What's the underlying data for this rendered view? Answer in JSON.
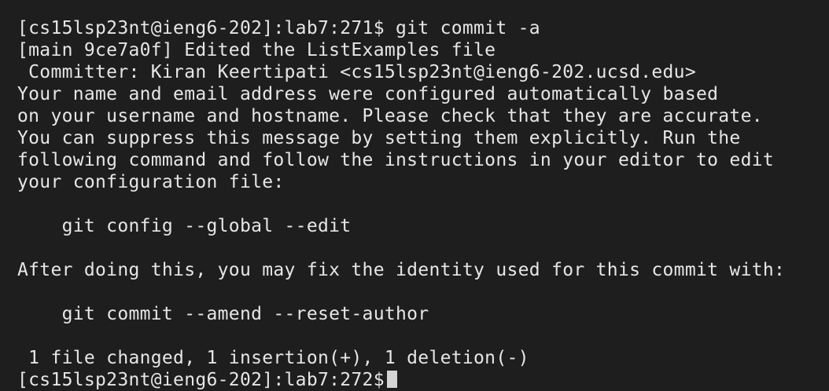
{
  "terminal": {
    "lines": [
      "[cs15lsp23nt@ieng6-202]:lab7:271$ git commit -a",
      "[main 9ce7a0f] Edited the ListExamples file",
      " Committer: Kiran Keertipati <cs15lsp23nt@ieng6-202.ucsd.edu>",
      "Your name and email address were configured automatically based",
      "on your username and hostname. Please check that they are accurate.",
      "You can suppress this message by setting them explicitly. Run the",
      "following command and follow the instructions in your editor to edit",
      "your configuration file:",
      "",
      "    git config --global --edit",
      "",
      "After doing this, you may fix the identity used for this commit with:",
      "",
      "    git commit --amend --reset-author",
      "",
      " 1 file changed, 1 insertion(+), 1 deletion(-)"
    ],
    "prompt": "[cs15lsp23nt@ieng6-202]:lab7:272$"
  },
  "colors": {
    "background": "#1e1e1e",
    "foreground": "#e6e6e6",
    "cursor": "#d4d4d4"
  }
}
